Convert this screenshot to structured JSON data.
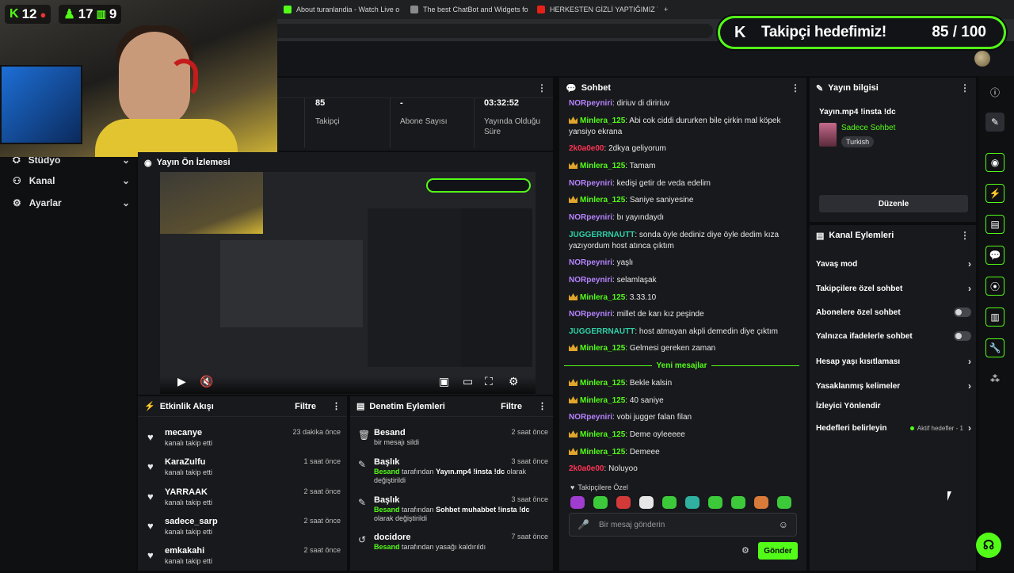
{
  "browser": {
    "tabs": [
      {
        "label": "About turanlandia - Watch Live o",
        "color": "#53fc18"
      },
      {
        "label": "The best ChatBot and Widgets fo",
        "color": "#8a8a8a"
      },
      {
        "label": "HERKESTEN GİZLİ YAPTIĞIMIZ YE",
        "color": "#e62117"
      }
    ],
    "new_tab": "+"
  },
  "goal": {
    "title": "Takipçi hedefimiz!",
    "value": "85 / 100"
  },
  "webcam_stats": {
    "kick_count": "12",
    "green_count": "17",
    "bars_count": "9"
  },
  "nav": [
    {
      "label": "Stüdyo",
      "icon": "studio-icon"
    },
    {
      "label": "Kanal",
      "icon": "channel-icon"
    },
    {
      "label": "Ayarlar",
      "icon": "settings-icon"
    }
  ],
  "stats": [
    {
      "value": "85",
      "label": "Takipçi"
    },
    {
      "value": "-",
      "label": "Abone Sayısı"
    },
    {
      "value": "03:32:52",
      "label": "Yayında Olduğu Süre"
    }
  ],
  "preview": {
    "title": "Yayın Ön İzlemesi"
  },
  "activity": {
    "title": "Etkinlik Akışı",
    "filter": "Filtre",
    "items": [
      {
        "name": "mecanye",
        "sub": "kanalı takip etti",
        "time": "23 dakika önce"
      },
      {
        "name": "KaraZulfu",
        "sub": "kanalı takip etti",
        "time": "1 saat önce"
      },
      {
        "name": "YARRAAK",
        "sub": "kanalı takip etti",
        "time": "2 saat önce"
      },
      {
        "name": "sadece_sarp",
        "sub": "kanalı takip etti",
        "time": "2 saat önce"
      },
      {
        "name": "emkakahi",
        "sub": "kanalı takip etti",
        "time": "2 saat önce"
      }
    ]
  },
  "moderation": {
    "title": "Denetim Eylemleri",
    "filter": "Filtre",
    "items": [
      {
        "name": "Besand",
        "time": "2 saat önce",
        "actor": "",
        "text": "bir mesajı sildi",
        "obj": "",
        "tail": ""
      },
      {
        "name": "Başlık",
        "time": "3 saat önce",
        "actor": "Besand",
        "text": " tarafından ",
        "obj": "Yayın.mp4 !insta !dc",
        "tail": " olarak değiştirildi"
      },
      {
        "name": "Başlık",
        "time": "3 saat önce",
        "actor": "Besand",
        "text": " tarafından ",
        "obj": "Sohbet muhabbet !insta !dc",
        "tail": " olarak değiştirildi"
      },
      {
        "name": "docidore",
        "time": "7 saat önce",
        "actor": "Besand",
        "text": " tarafından yasağı kaldırıldı",
        "obj": "",
        "tail": ""
      }
    ]
  },
  "chat": {
    "title": "Sohbet",
    "new_messages": "Yeni mesajlar",
    "followers_only": "Takipçilere Özel",
    "placeholder": "Bir mesaj gönderin",
    "send": "Gönder",
    "messages": [
      {
        "user": "NORpeyniri",
        "color": "#b583ff",
        "crown": false,
        "text": "diriuv di diririuv"
      },
      {
        "user": "Minlera_125",
        "color": "#53fc18",
        "crown": true,
        "text": "Abi cok ciddi dururken bile çirkin mal köpek yansiyo ekrana"
      },
      {
        "user": "2k0a0e00",
        "color": "#ff3355",
        "crown": false,
        "text": "2dkya geliyorum"
      },
      {
        "user": "Minlera_125",
        "color": "#53fc18",
        "crown": true,
        "text": "Tamam"
      },
      {
        "user": "NORpeyniri",
        "color": "#b583ff",
        "crown": false,
        "text": "kedişi getir de veda edelim"
      },
      {
        "user": "Minlera_125",
        "color": "#53fc18",
        "crown": true,
        "text": "Saniye saniyesine"
      },
      {
        "user": "NORpeyniri",
        "color": "#b583ff",
        "crown": false,
        "text": "bı yayındaydı"
      },
      {
        "user": "JUGGERRNAUTT",
        "color": "#2fd0a8",
        "crown": false,
        "text": "sonda öyle dediniz diye öyle dedim kıza yazıyordum host atınca çıktım"
      },
      {
        "user": "NORpeyniri",
        "color": "#b583ff",
        "crown": false,
        "text": "yaşlı"
      },
      {
        "user": "NORpeyniri",
        "color": "#b583ff",
        "crown": false,
        "text": "selamlaşak"
      },
      {
        "user": "Minlera_125",
        "color": "#53fc18",
        "crown": true,
        "text": "3.33.10"
      },
      {
        "user": "NORpeyniri",
        "color": "#b583ff",
        "crown": false,
        "text": "millet de karı kız peşinde"
      },
      {
        "user": "JUGGERRNAUTT",
        "color": "#2fd0a8",
        "crown": false,
        "text": "host atmayan akpli demedin diye çıktım"
      },
      {
        "user": "Minlera_125",
        "color": "#53fc18",
        "crown": true,
        "text": "Gelmesi gereken zaman"
      },
      {
        "user": "Minlera_125",
        "color": "#53fc18",
        "crown": true,
        "text": "Bekle kalsin"
      },
      {
        "user": "Minlera_125",
        "color": "#53fc18",
        "crown": true,
        "text": "40 saniye"
      },
      {
        "user": "NORpeyniri",
        "color": "#b583ff",
        "crown": false,
        "text": "vobi jugger falan filan"
      },
      {
        "user": "Minlera_125",
        "color": "#53fc18",
        "crown": true,
        "text": "Deme oyleeeee"
      },
      {
        "user": "Minlera_125",
        "color": "#53fc18",
        "crown": true,
        "text": "Demeee"
      },
      {
        "user": "2k0a0e00",
        "color": "#ff3355",
        "crown": false,
        "text": "Noluyoo"
      }
    ]
  },
  "stream_info": {
    "title": "Yayın bilgisi",
    "stream_title": "Yayın.mp4 !insta !dc",
    "category": "Sadece Sohbet",
    "language": "Turkish",
    "edit": "Düzenle"
  },
  "channel_actions": {
    "title": "Kanal Eylemleri",
    "items": [
      {
        "label": "Yavaş mod",
        "kind": "chevron"
      },
      {
        "label": "Takipçilere özel sohbet",
        "kind": "chevron"
      },
      {
        "label": "Abonelere özel sohbet",
        "kind": "toggle"
      },
      {
        "label": "Yalnızca ifadelerle sohbet",
        "kind": "toggle"
      },
      {
        "label": "Hesap yaşı kısıtlaması",
        "kind": "chevron"
      },
      {
        "label": "Yasaklanmış kelimeler",
        "kind": "chevron"
      },
      {
        "label": "İzleyici Yönlendir",
        "kind": "none"
      },
      {
        "label": "Hedefleri belirleyin",
        "kind": "goal"
      }
    ],
    "goals_status": "Aktif hedefler - 1"
  }
}
